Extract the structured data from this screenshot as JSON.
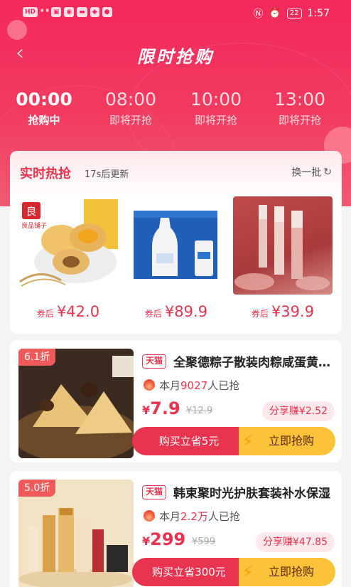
{
  "status_bar": {
    "left_labels": [
      "HD",
      "4G",
      "4G"
    ],
    "time": "1:57",
    "battery": "22"
  },
  "nav": {
    "title": "限时抢购"
  },
  "time_tabs": [
    {
      "time": "00:00",
      "status": "抢购中",
      "active": true
    },
    {
      "time": "08:00",
      "status": "即将开抢",
      "active": false
    },
    {
      "time": "10:00",
      "status": "即将开抢",
      "active": false
    },
    {
      "time": "13:00",
      "status": "即将开抢",
      "active": false
    }
  ],
  "hot": {
    "title": "实时热抢",
    "update_text": "17s后更新",
    "refresh_label": "换一批",
    "items": [
      {
        "prefix": "券后",
        "price": "¥42.0",
        "brand_text": "良品铺子"
      },
      {
        "prefix": "券后",
        "price": "¥89.9"
      },
      {
        "prefix": "券后",
        "price": "¥39.9"
      }
    ]
  },
  "products": [
    {
      "discount": "6.1折",
      "tag": "天猫",
      "title": "全聚德粽子散装肉粽咸蛋黄鲜肉粽",
      "sold_prefix": "本月",
      "sold_count": "9027",
      "sold_suffix": "人已抢",
      "price_currency": "¥",
      "price": "7.9",
      "old_price": "¥12.9",
      "share_text": "分享赚¥2.52",
      "buy_left": "购买立省5元",
      "buy_right": "立即抢购"
    },
    {
      "discount": "5.0折",
      "tag": "天猫",
      "title": "韩束聚时光护肤套装补水保湿",
      "sold_prefix": "本月",
      "sold_count": "2.2万",
      "sold_suffix": "人已抢",
      "price_currency": "¥",
      "price": "299",
      "old_price": "¥599",
      "share_text": "分享赚¥47.85",
      "buy_left": "购买立省300元",
      "buy_right": "立即抢购"
    }
  ]
}
